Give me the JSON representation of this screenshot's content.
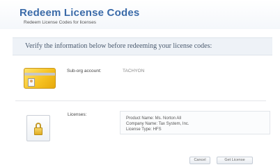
{
  "header": {
    "title": "Redeem License Codes",
    "subtitle": "Redeem License Codes for licenses"
  },
  "verify": {
    "message": "Verify the information below before redeeming your license codes:"
  },
  "account": {
    "label": "Sub-org account:",
    "value": "TACHYON",
    "icon": "account-card-icon"
  },
  "licenses": {
    "label": "Licenses:",
    "icon": "lock-icon",
    "details": {
      "product_name": "Product Name: Ms. Norton All",
      "company_name": "Company Name: Tax System, Inc.",
      "license_type": "License Type: HFS"
    }
  },
  "buttons": {
    "cancel": "Cancel",
    "get_license": "Get License"
  },
  "colors": {
    "title": "#3a6aa8",
    "verify_bar": "#eef2f7",
    "card_gold": "#f5c020"
  }
}
